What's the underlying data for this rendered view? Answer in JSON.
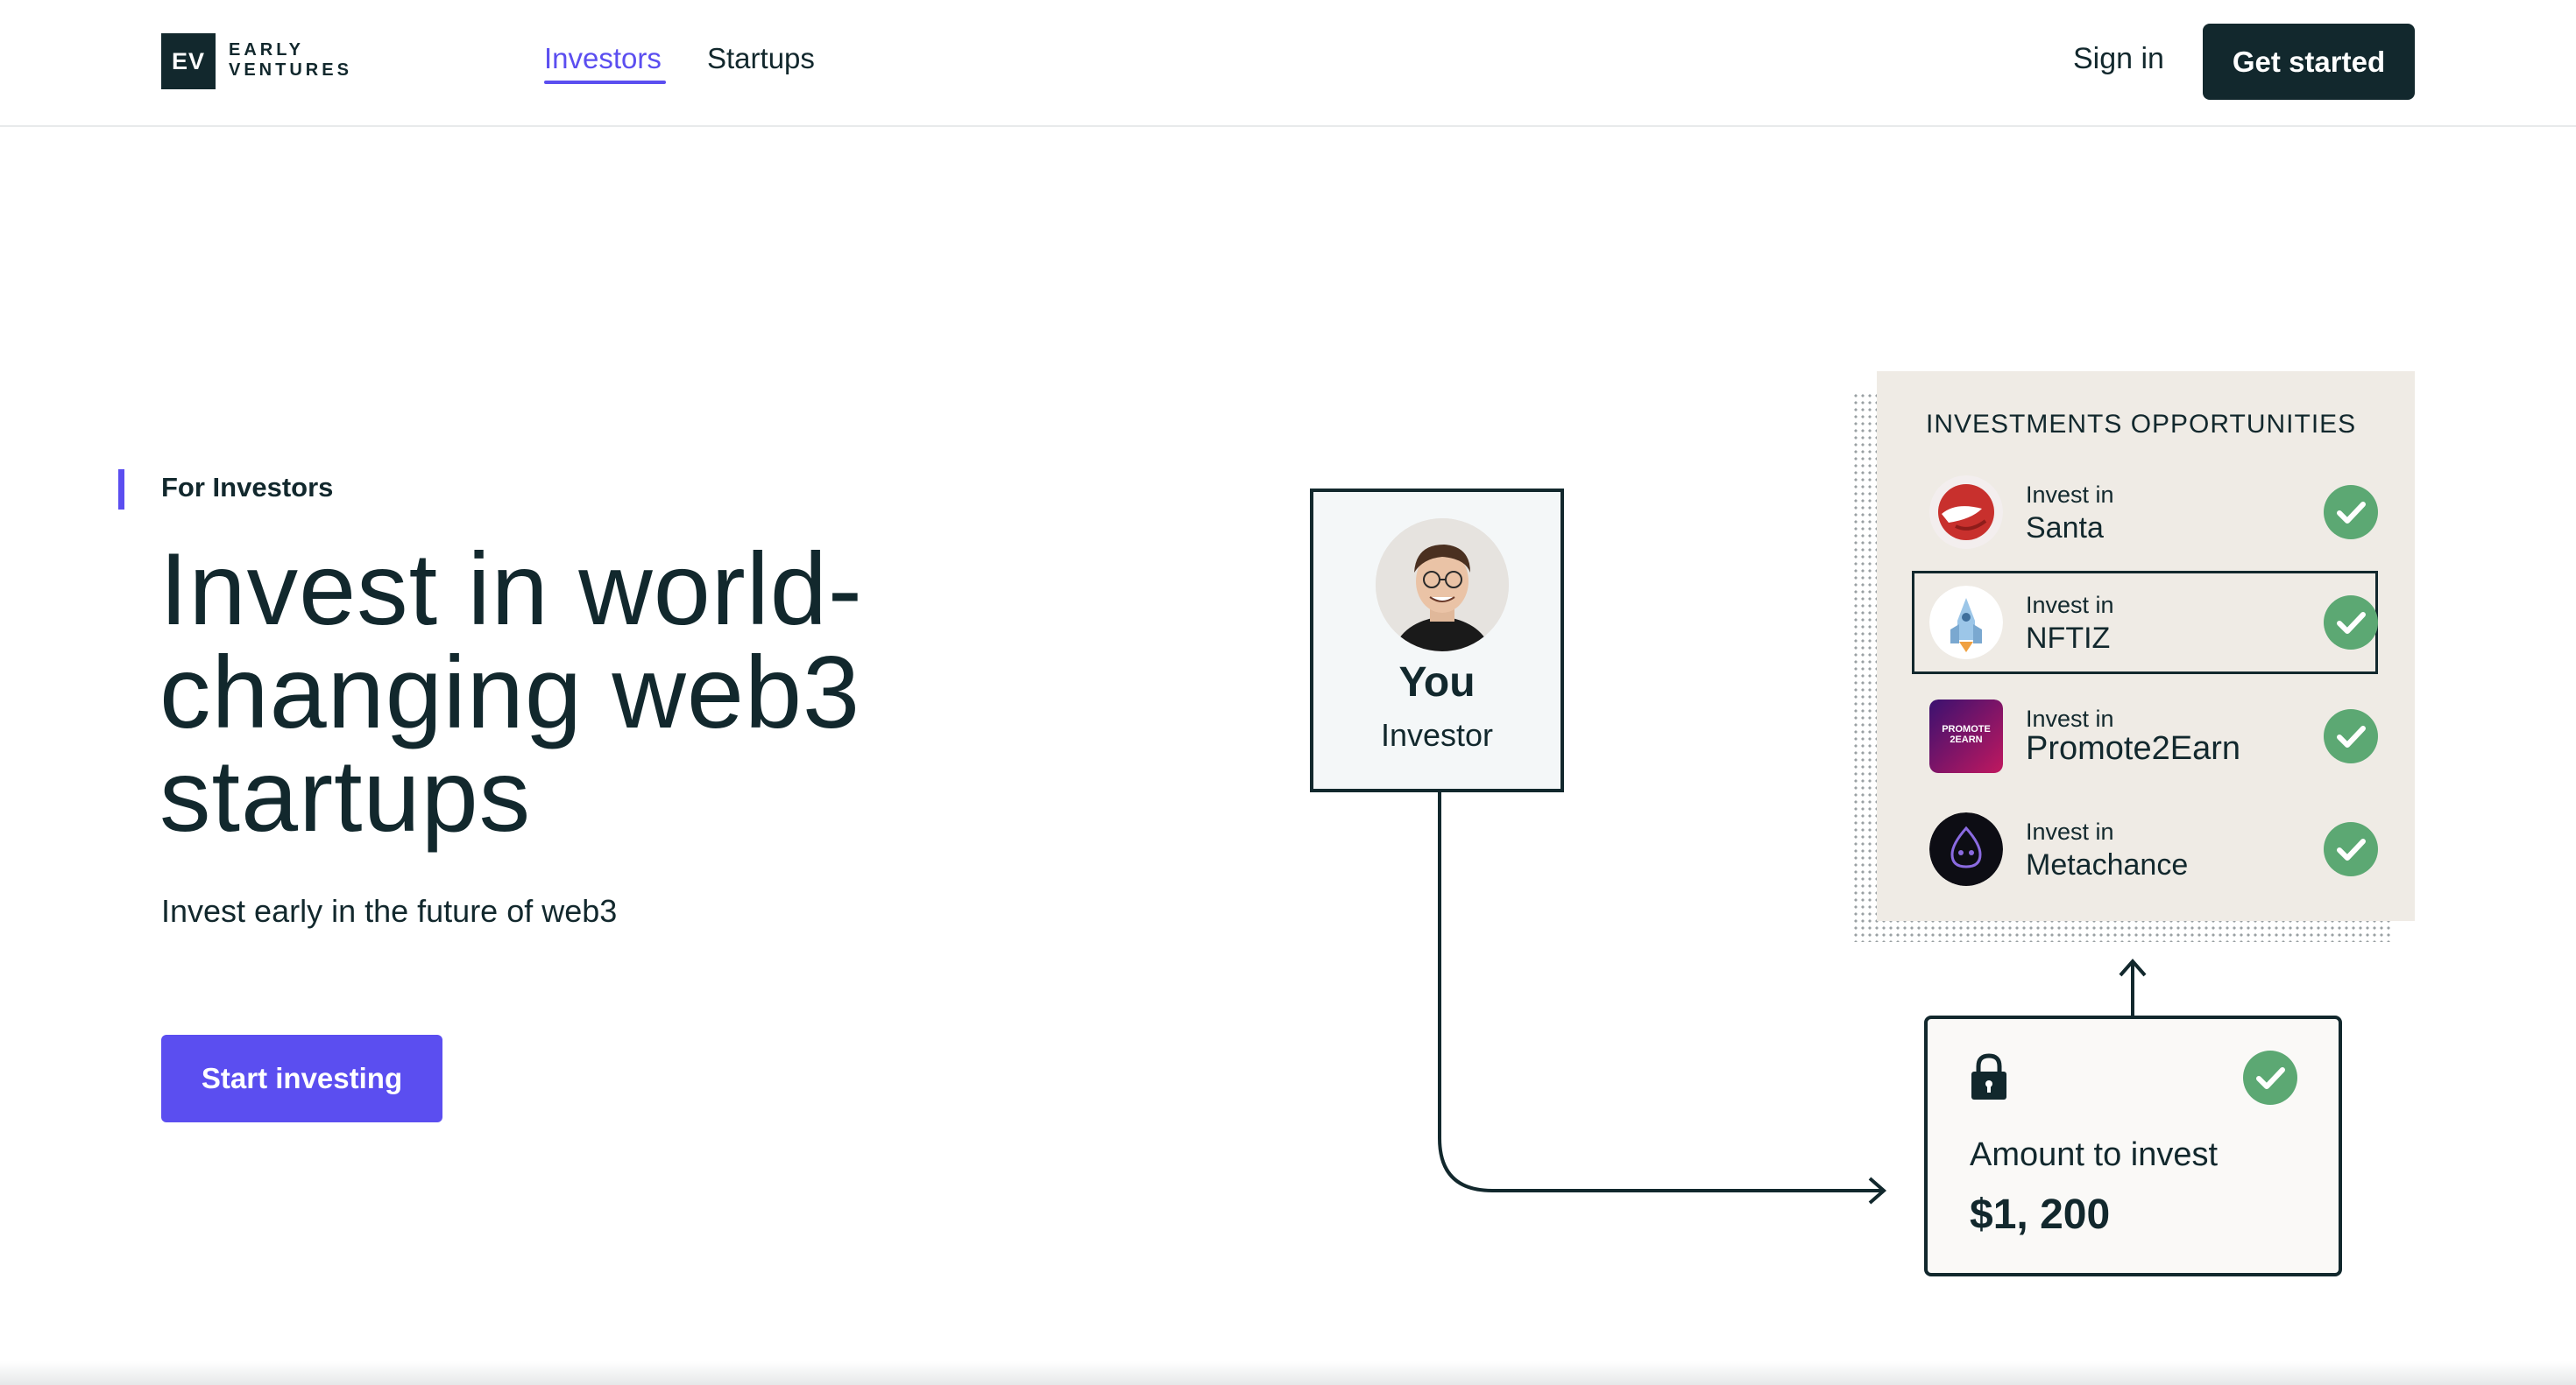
{
  "header": {
    "logo_mark": "EV",
    "logo_line1": "EARLY",
    "logo_line2": "VENTURES",
    "nav": [
      {
        "label": "Investors",
        "active": true
      },
      {
        "label": "Startups",
        "active": false
      }
    ],
    "sign_in": "Sign in",
    "get_started": "Get started"
  },
  "hero": {
    "eyebrow": "For Investors",
    "headline_line1": "Invest in world-",
    "headline_line2": "changing web3",
    "headline_line3": "startups",
    "subline": "Invest early in the future of web3",
    "cta": "Start investing"
  },
  "you_card": {
    "name": "You",
    "role": "Investor"
  },
  "opportunities": {
    "title": "INVESTMENTS OPPORTUNITIES",
    "items": [
      {
        "prefix": "Invest in",
        "name": "Santa",
        "logo_icon": "santa-logo-icon",
        "selected": false,
        "checked": true
      },
      {
        "prefix": "Invest in",
        "name": "NFTIZ",
        "logo_icon": "nftiz-logo-icon",
        "selected": true,
        "checked": true
      },
      {
        "prefix": "Invest in",
        "name": "Promote2Earn",
        "logo_icon": "promote2earn-logo-icon",
        "selected": false,
        "checked": true
      },
      {
        "prefix": "Invest in",
        "name": "Metachance",
        "logo_icon": "metachance-logo-icon",
        "selected": false,
        "checked": true
      }
    ],
    "promote_logo_text": "PROMOTE 2EARN"
  },
  "amount_card": {
    "label": "Amount to invest",
    "value": "$1, 200"
  },
  "colors": {
    "accent": "#5b4ef0",
    "dark": "#12282d",
    "panel": "#efebe5",
    "check": "#5ca873"
  }
}
